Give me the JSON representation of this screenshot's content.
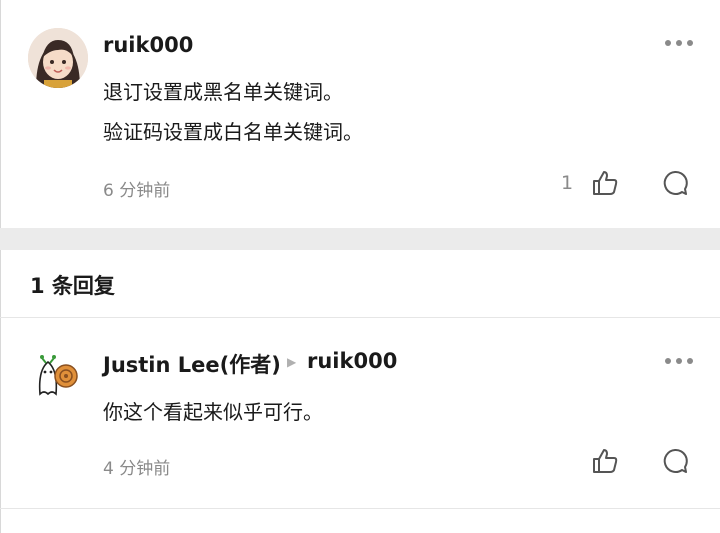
{
  "main_comment": {
    "username": "ruik000",
    "lines": [
      "退订设置成黑名单关键词。",
      "验证码设置成白名单关键词。"
    ],
    "time": "6 分钟前",
    "like_count": "1"
  },
  "replies_header": "1 条回复",
  "reply": {
    "author": "Justin Lee(作者)",
    "reply_to": "ruik000",
    "text": "你这个看起来似乎可行。",
    "time": "4 分钟前"
  }
}
